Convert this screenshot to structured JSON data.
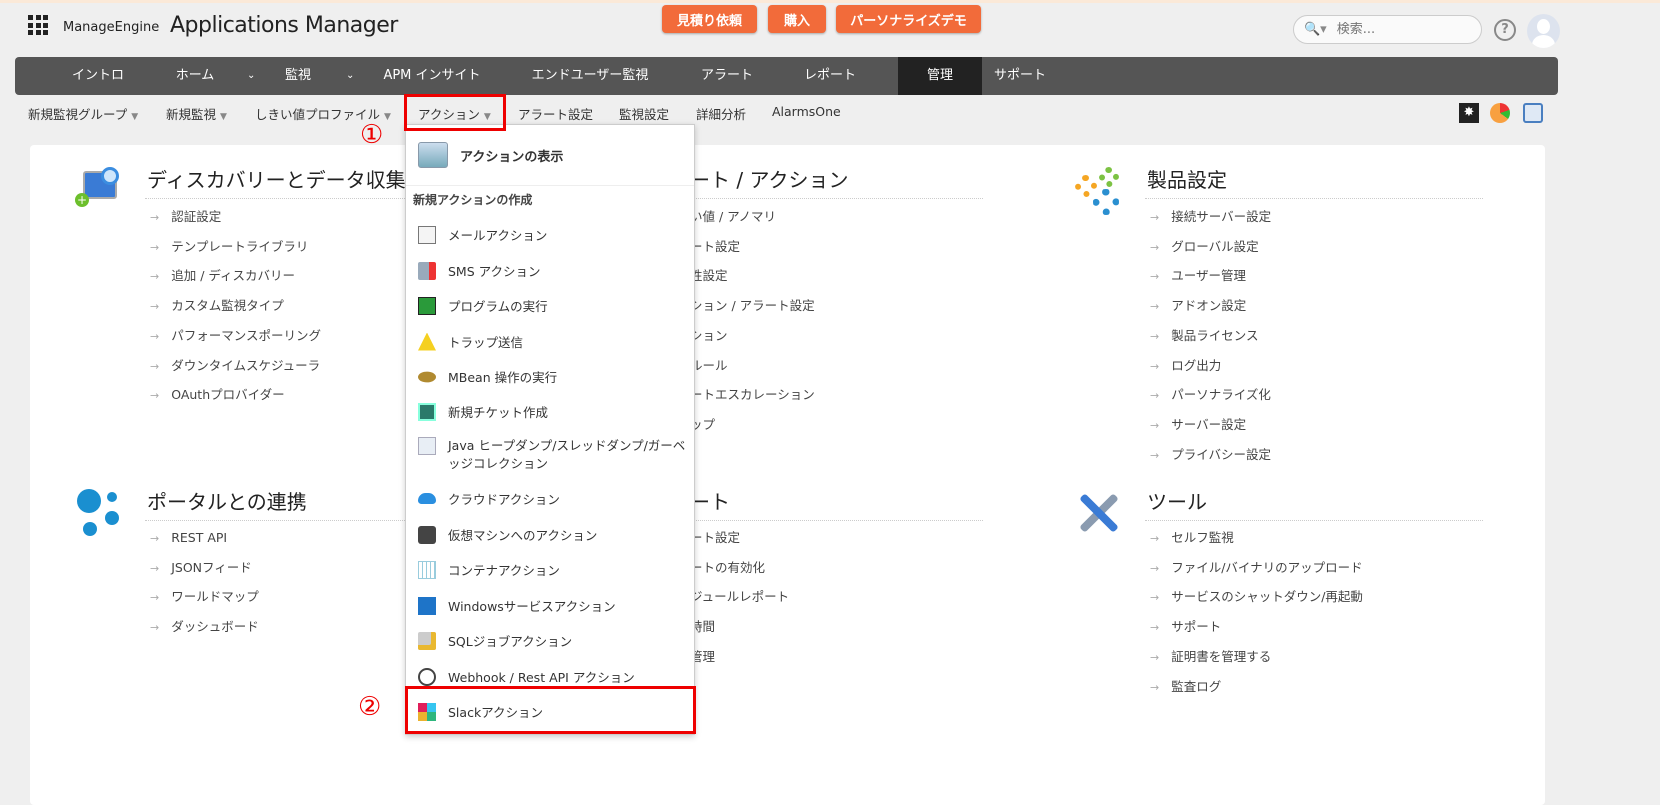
{
  "header": {
    "brand": "ManageEngine",
    "product": "Applications Manager",
    "buttons": [
      "見積り依頼",
      "購入",
      "パーソナライズデモ"
    ],
    "search_placeholder": "検索...",
    "help": "?"
  },
  "nav": {
    "items": [
      "イントロ",
      "ホーム",
      "監視",
      "APM インサイト",
      "エンドユーザー監視",
      "アラート",
      "レポート",
      "管理",
      "サポート"
    ],
    "active": "管理"
  },
  "subnav": {
    "items": [
      "新規監視グループ",
      "新規監視",
      "しきい値プロファイル",
      "アクション",
      "アラート設定",
      "監視設定",
      "詳細分析",
      "AlarmsOne"
    ]
  },
  "annotations": {
    "step1": "①",
    "step2": "②"
  },
  "dropdown": {
    "view": "アクションの表示",
    "create_header": "新規アクションの作成",
    "items": [
      "メールアクション",
      "SMS アクション",
      "プログラムの実行",
      "トラップ送信",
      "MBean 操作の実行",
      "新規チケット作成",
      "Java ヒープダンプ/スレッドダンプ/ガーベッジコレクション",
      "クラウドアクション",
      "仮想マシンへのアクション",
      "コンテナアクション",
      "Windowsサービスアクション",
      "SQLジョブアクション",
      "Webhook / Rest API アクション",
      "Slackアクション"
    ]
  },
  "sections": {
    "discovery": {
      "title": "ディスカバリーとデータ収集",
      "items": [
        "認証設定",
        "テンプレートライブラリ",
        "追加 / ディスカバリー",
        "カスタム監視タイプ",
        "パフォーマンスポーリング",
        "ダウンタイムスケジューラ",
        "OAuthプロバイダー"
      ]
    },
    "alert_action": {
      "title": "ート / アクション",
      "items": [
        "い値 / アノマリ",
        "ート設定",
        "性設定",
        "ション / アラート設定",
        "ション",
        "ルール",
        "ートエスカレーション",
        "ップ"
      ]
    },
    "product": {
      "title": "製品設定",
      "items": [
        "接続サーバー設定",
        "グローバル設定",
        "ユーザー管理",
        "アドオン設定",
        "製品ライセンス",
        "ログ出力",
        "パーソナライズ化",
        "サーバー設定",
        "プライバシー設定"
      ]
    },
    "portal": {
      "title": "ポータルとの連携",
      "items": [
        "REST API",
        "JSONフィード",
        "ワールドマップ",
        "ダッシュボード"
      ]
    },
    "report": {
      "title": "ート",
      "items": [
        "ート設定",
        "ートの有効化",
        "ジュールレポート",
        "時間",
        "管理"
      ]
    },
    "tools": {
      "title": "ツール",
      "items": [
        "セルフ監視",
        "ファイル/バイナリのアップロード",
        "サービスのシャットダウン/再起動",
        "サポート",
        "証明書を管理する",
        "監査ログ"
      ]
    }
  }
}
